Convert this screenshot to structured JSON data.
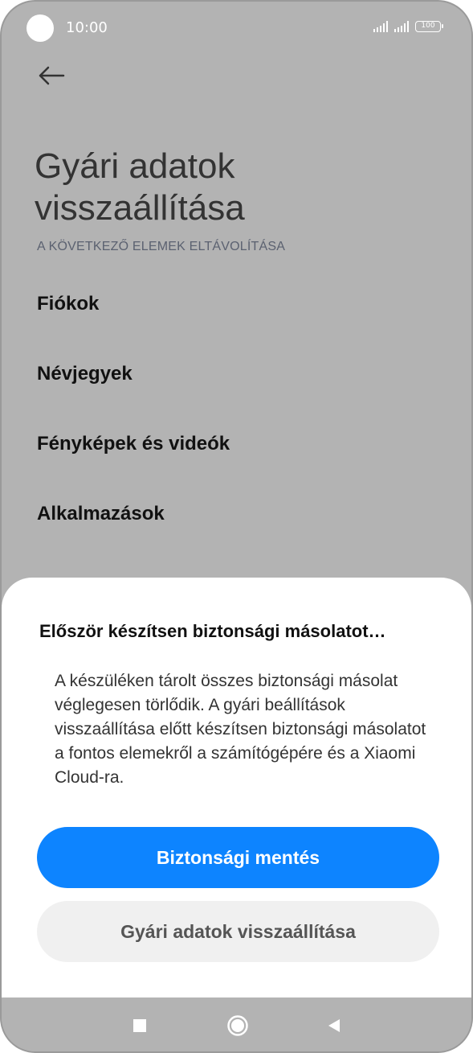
{
  "status_bar": {
    "time": "10:00",
    "battery": "100"
  },
  "header": {
    "back_icon": "arrow-left-icon",
    "title": "Gyári adatok visszaállítása"
  },
  "section": {
    "header": "A KÖVETKEZŐ ELEMEK ELTÁVOLÍTÁSA",
    "items": [
      {
        "label": "Fiókok"
      },
      {
        "label": "Névjegyek"
      },
      {
        "label": "Fényképek és videók"
      },
      {
        "label": "Alkalmazások"
      }
    ]
  },
  "dialog": {
    "title": "Először készítsen biztonsági másolatot…",
    "body": "A készüléken tárolt összes biztonsági másolat véglegesen törlődik. A gyári beállítások visszaállítása előtt készítsen biztonsági másolatot a fontos elemekről a számítógépére és a Xiaomi Cloud-ra.",
    "primary_button": "Biztonsági mentés",
    "secondary_button": "Gyári adatok visszaállítása"
  },
  "nav_bar": {
    "icons": [
      "square-recents-icon",
      "circle-home-icon",
      "triangle-back-icon"
    ]
  },
  "colors": {
    "primary": "#0d84ff",
    "scrim": "#b3b3b3",
    "secondary_button_bg": "#f0f0f0"
  }
}
